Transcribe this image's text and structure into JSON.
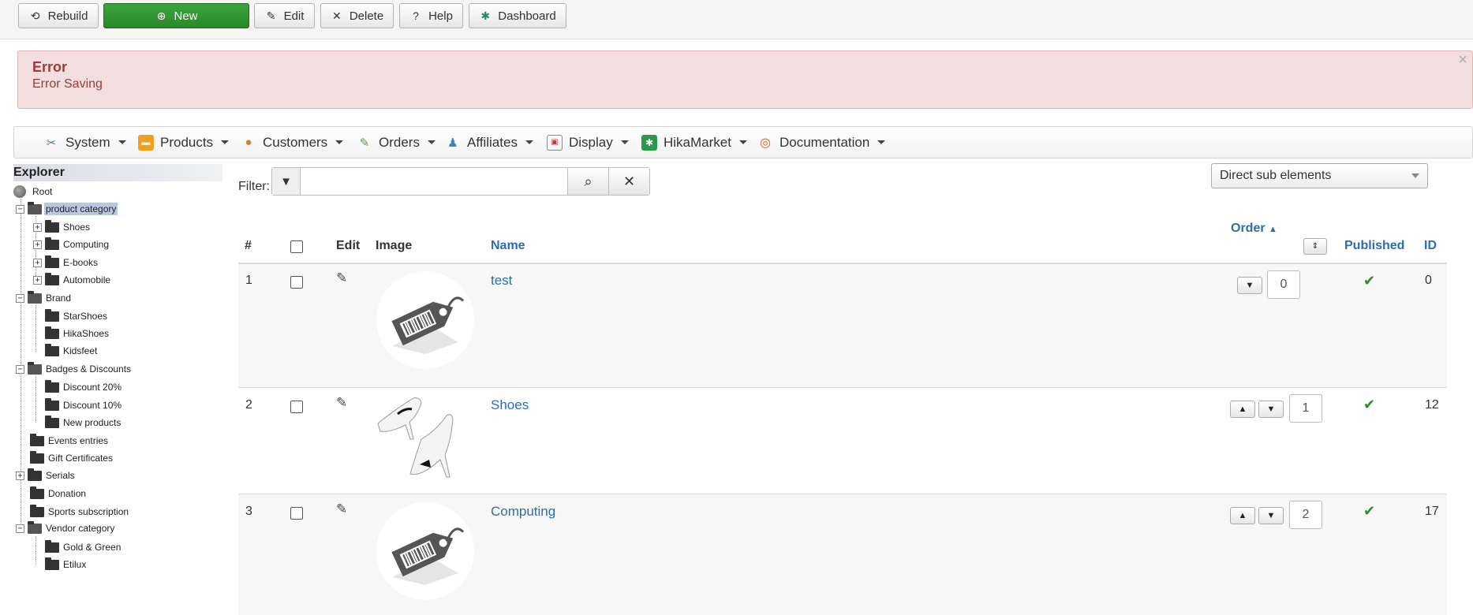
{
  "toolbar": {
    "rebuild": "Rebuild",
    "new": "New",
    "edit": "Edit",
    "delete": "Delete",
    "help": "Help",
    "dashboard": "Dashboard"
  },
  "alert": {
    "title": "Error",
    "message": "Error Saving",
    "close": "×"
  },
  "menu": {
    "system": "System",
    "products": "Products",
    "customers": "Customers",
    "orders": "Orders",
    "affiliates": "Affiliates",
    "display": "Display",
    "hikamarket": "HikaMarket",
    "documentation": "Documentation"
  },
  "explorer": {
    "title": "Explorer",
    "root": "Root",
    "items": {
      "product_category": "product category",
      "shoes": "Shoes",
      "computing": "Computing",
      "ebooks": "E-books",
      "automobile": "Automobile",
      "brand": "Brand",
      "starshoes": "StarShoes",
      "hikashoes": "HikaShoes",
      "kidsfeet": "Kidsfeet",
      "badges": "Badges & Discounts",
      "discount20": "Discount 20%",
      "discount10": "Discount 10%",
      "newproducts": "New products",
      "events": "Events entries",
      "gift": "Gift Certificates",
      "serials": "Serials",
      "donation": "Donation",
      "sports": "Sports subscription",
      "vendor": "Vendor category",
      "goldgreen": "Gold & Green",
      "etilux": "Etilux"
    }
  },
  "filter": {
    "label": "Filter:",
    "value": "",
    "scope_selected": "Direct sub elements"
  },
  "table": {
    "headers": {
      "num": "#",
      "edit": "Edit",
      "image": "Image",
      "name": "Name",
      "order": "Order",
      "published": "Published",
      "id": "ID"
    },
    "rows": [
      {
        "num": "1",
        "name": "test",
        "order": "0",
        "id": "0",
        "image": "price-tag-icon"
      },
      {
        "num": "2",
        "name": "Shoes",
        "order": "1",
        "id": "12",
        "image": "high-heel-shoes"
      },
      {
        "num": "3",
        "name": "Computing",
        "order": "2",
        "id": "17",
        "image": "price-tag-icon"
      }
    ]
  },
  "colors": {
    "new_button": "#2f962f",
    "alert_bg": "#f2dede",
    "alert_text": "#9c3b3b",
    "link": "#2a6db0",
    "published_check": "#2e8b2e"
  }
}
